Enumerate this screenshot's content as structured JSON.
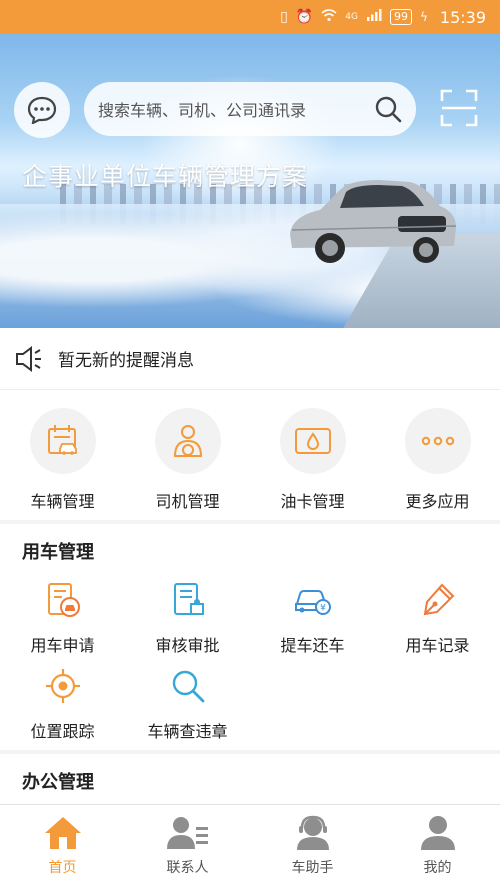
{
  "status_bar": {
    "battery": "99",
    "network": "4G",
    "time": "15:39"
  },
  "header": {
    "search_placeholder": "搜索车辆、司机、公司通讯录",
    "icons": {
      "chat": "chat-bubble-icon",
      "search": "search-icon",
      "scan": "scan-icon"
    }
  },
  "banner": {
    "title": "企事业单位车辆管理方案",
    "slide_count": 3,
    "active_slide": 2
  },
  "notice": {
    "text": "暂无新的提醒消息",
    "icon": "speaker-icon"
  },
  "quick_apps": [
    {
      "label": "车辆管理",
      "icon": "vehicle-calendar-icon"
    },
    {
      "label": "司机管理",
      "icon": "driver-icon"
    },
    {
      "label": "油卡管理",
      "icon": "fuel-card-icon"
    },
    {
      "label": "更多应用",
      "icon": "more-icon"
    }
  ],
  "car_section": {
    "title": "用车管理",
    "items": [
      {
        "label": "用车申请",
        "icon": "apply-icon",
        "color": "#f39a3a"
      },
      {
        "label": "审核审批",
        "icon": "approve-icon",
        "color": "#35a7d8"
      },
      {
        "label": "提车还车",
        "icon": "car-pickup-icon",
        "color": "#3b8ed8"
      },
      {
        "label": "用车记录",
        "icon": "pen-record-icon",
        "color": "#f07a3a"
      },
      {
        "label": "位置跟踪",
        "icon": "location-target-icon",
        "color": "#f39a3a"
      },
      {
        "label": "车辆查违章",
        "icon": "search-violation-icon",
        "color": "#35a7d8"
      }
    ]
  },
  "office_section": {
    "title": "办公管理"
  },
  "tabs": [
    {
      "label": "首页",
      "icon": "home-icon",
      "active": true
    },
    {
      "label": "联系人",
      "icon": "contacts-icon",
      "active": false
    },
    {
      "label": "车助手",
      "icon": "assistant-icon",
      "active": false
    },
    {
      "label": "我的",
      "icon": "profile-icon",
      "active": false
    }
  ],
  "colors": {
    "accent": "#f39a3a",
    "dot_active": "#e3262c",
    "icon_gray": "#8e8e8e"
  }
}
